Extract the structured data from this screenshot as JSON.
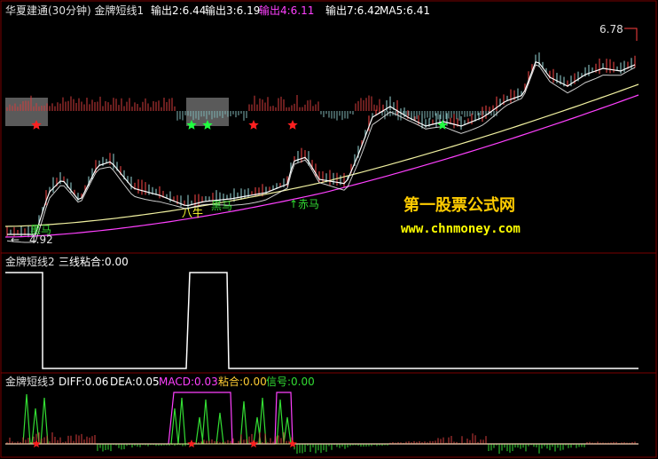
{
  "header": {
    "title": "华夏建通(30分钟) 金牌短线1",
    "out2": "输出2:6.44",
    "out3": "输出3:6.19",
    "out4": "输出4:6.11",
    "out7": "输出7:6.42",
    "ma5": "MA5:6.41"
  },
  "main_panel": {
    "price_high_label": "6.78",
    "price_low_label": "4.92",
    "buy_label_1": "黑马",
    "buy_label_2": "八牛",
    "buy_label_3": "黑马",
    "buy_label_4": "↑赤马",
    "watermark_title": "第一股票公式网",
    "watermark_url": "www.chnmoney.com"
  },
  "panel2": {
    "title": "金牌短线2",
    "value": "三线粘合:0.00"
  },
  "panel3": {
    "title": "金牌短线3",
    "diff": "DIFF:0.06",
    "dea": "DEA:0.05",
    "macd": "MACD:0.03",
    "nianhe": "粘合:0.00",
    "signal": "信号:0.00"
  },
  "colors": {
    "background": "#000000",
    "frame": "#7a0000",
    "up": "#d23c3c",
    "down": "#7fb5b5",
    "white_line": "#ffffff",
    "yellow_line": "#f0f0a0",
    "magenta_line": "#ff40ff",
    "green": "#33dd33",
    "star_red": "#ff2020",
    "star_green": "#20ff40",
    "watermark_title": "#ffcc00",
    "watermark_url": "#ffff00"
  }
}
